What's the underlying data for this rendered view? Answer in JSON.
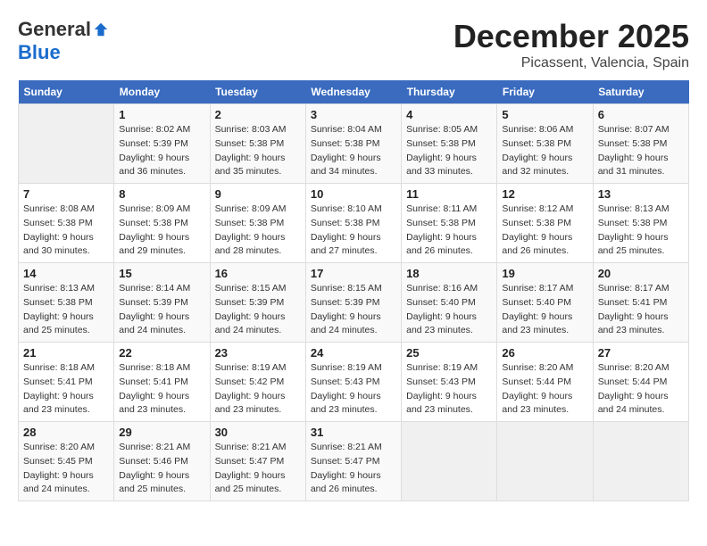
{
  "header": {
    "logo_general": "General",
    "logo_blue": "Blue",
    "month_title": "December 2025",
    "subtitle": "Picassent, Valencia, Spain"
  },
  "days_of_week": [
    "Sunday",
    "Monday",
    "Tuesday",
    "Wednesday",
    "Thursday",
    "Friday",
    "Saturday"
  ],
  "weeks": [
    [
      {
        "day": "",
        "empty": true
      },
      {
        "day": "1",
        "sunrise": "Sunrise: 8:02 AM",
        "sunset": "Sunset: 5:39 PM",
        "daylight": "Daylight: 9 hours and 36 minutes."
      },
      {
        "day": "2",
        "sunrise": "Sunrise: 8:03 AM",
        "sunset": "Sunset: 5:38 PM",
        "daylight": "Daylight: 9 hours and 35 minutes."
      },
      {
        "day": "3",
        "sunrise": "Sunrise: 8:04 AM",
        "sunset": "Sunset: 5:38 PM",
        "daylight": "Daylight: 9 hours and 34 minutes."
      },
      {
        "day": "4",
        "sunrise": "Sunrise: 8:05 AM",
        "sunset": "Sunset: 5:38 PM",
        "daylight": "Daylight: 9 hours and 33 minutes."
      },
      {
        "day": "5",
        "sunrise": "Sunrise: 8:06 AM",
        "sunset": "Sunset: 5:38 PM",
        "daylight": "Daylight: 9 hours and 32 minutes."
      },
      {
        "day": "6",
        "sunrise": "Sunrise: 8:07 AM",
        "sunset": "Sunset: 5:38 PM",
        "daylight": "Daylight: 9 hours and 31 minutes."
      }
    ],
    [
      {
        "day": "7",
        "sunrise": "Sunrise: 8:08 AM",
        "sunset": "Sunset: 5:38 PM",
        "daylight": "Daylight: 9 hours and 30 minutes."
      },
      {
        "day": "8",
        "sunrise": "Sunrise: 8:09 AM",
        "sunset": "Sunset: 5:38 PM",
        "daylight": "Daylight: 9 hours and 29 minutes."
      },
      {
        "day": "9",
        "sunrise": "Sunrise: 8:09 AM",
        "sunset": "Sunset: 5:38 PM",
        "daylight": "Daylight: 9 hours and 28 minutes."
      },
      {
        "day": "10",
        "sunrise": "Sunrise: 8:10 AM",
        "sunset": "Sunset: 5:38 PM",
        "daylight": "Daylight: 9 hours and 27 minutes."
      },
      {
        "day": "11",
        "sunrise": "Sunrise: 8:11 AM",
        "sunset": "Sunset: 5:38 PM",
        "daylight": "Daylight: 9 hours and 26 minutes."
      },
      {
        "day": "12",
        "sunrise": "Sunrise: 8:12 AM",
        "sunset": "Sunset: 5:38 PM",
        "daylight": "Daylight: 9 hours and 26 minutes."
      },
      {
        "day": "13",
        "sunrise": "Sunrise: 8:13 AM",
        "sunset": "Sunset: 5:38 PM",
        "daylight": "Daylight: 9 hours and 25 minutes."
      }
    ],
    [
      {
        "day": "14",
        "sunrise": "Sunrise: 8:13 AM",
        "sunset": "Sunset: 5:38 PM",
        "daylight": "Daylight: 9 hours and 25 minutes."
      },
      {
        "day": "15",
        "sunrise": "Sunrise: 8:14 AM",
        "sunset": "Sunset: 5:39 PM",
        "daylight": "Daylight: 9 hours and 24 minutes."
      },
      {
        "day": "16",
        "sunrise": "Sunrise: 8:15 AM",
        "sunset": "Sunset: 5:39 PM",
        "daylight": "Daylight: 9 hours and 24 minutes."
      },
      {
        "day": "17",
        "sunrise": "Sunrise: 8:15 AM",
        "sunset": "Sunset: 5:39 PM",
        "daylight": "Daylight: 9 hours and 24 minutes."
      },
      {
        "day": "18",
        "sunrise": "Sunrise: 8:16 AM",
        "sunset": "Sunset: 5:40 PM",
        "daylight": "Daylight: 9 hours and 23 minutes."
      },
      {
        "day": "19",
        "sunrise": "Sunrise: 8:17 AM",
        "sunset": "Sunset: 5:40 PM",
        "daylight": "Daylight: 9 hours and 23 minutes."
      },
      {
        "day": "20",
        "sunrise": "Sunrise: 8:17 AM",
        "sunset": "Sunset: 5:41 PM",
        "daylight": "Daylight: 9 hours and 23 minutes."
      }
    ],
    [
      {
        "day": "21",
        "sunrise": "Sunrise: 8:18 AM",
        "sunset": "Sunset: 5:41 PM",
        "daylight": "Daylight: 9 hours and 23 minutes."
      },
      {
        "day": "22",
        "sunrise": "Sunrise: 8:18 AM",
        "sunset": "Sunset: 5:41 PM",
        "daylight": "Daylight: 9 hours and 23 minutes."
      },
      {
        "day": "23",
        "sunrise": "Sunrise: 8:19 AM",
        "sunset": "Sunset: 5:42 PM",
        "daylight": "Daylight: 9 hours and 23 minutes."
      },
      {
        "day": "24",
        "sunrise": "Sunrise: 8:19 AM",
        "sunset": "Sunset: 5:43 PM",
        "daylight": "Daylight: 9 hours and 23 minutes."
      },
      {
        "day": "25",
        "sunrise": "Sunrise: 8:19 AM",
        "sunset": "Sunset: 5:43 PM",
        "daylight": "Daylight: 9 hours and 23 minutes."
      },
      {
        "day": "26",
        "sunrise": "Sunrise: 8:20 AM",
        "sunset": "Sunset: 5:44 PM",
        "daylight": "Daylight: 9 hours and 23 minutes."
      },
      {
        "day": "27",
        "sunrise": "Sunrise: 8:20 AM",
        "sunset": "Sunset: 5:44 PM",
        "daylight": "Daylight: 9 hours and 24 minutes."
      }
    ],
    [
      {
        "day": "28",
        "sunrise": "Sunrise: 8:20 AM",
        "sunset": "Sunset: 5:45 PM",
        "daylight": "Daylight: 9 hours and 24 minutes."
      },
      {
        "day": "29",
        "sunrise": "Sunrise: 8:21 AM",
        "sunset": "Sunset: 5:46 PM",
        "daylight": "Daylight: 9 hours and 25 minutes."
      },
      {
        "day": "30",
        "sunrise": "Sunrise: 8:21 AM",
        "sunset": "Sunset: 5:47 PM",
        "daylight": "Daylight: 9 hours and 25 minutes."
      },
      {
        "day": "31",
        "sunrise": "Sunrise: 8:21 AM",
        "sunset": "Sunset: 5:47 PM",
        "daylight": "Daylight: 9 hours and 26 minutes."
      },
      {
        "day": "",
        "empty": true
      },
      {
        "day": "",
        "empty": true
      },
      {
        "day": "",
        "empty": true
      }
    ]
  ]
}
